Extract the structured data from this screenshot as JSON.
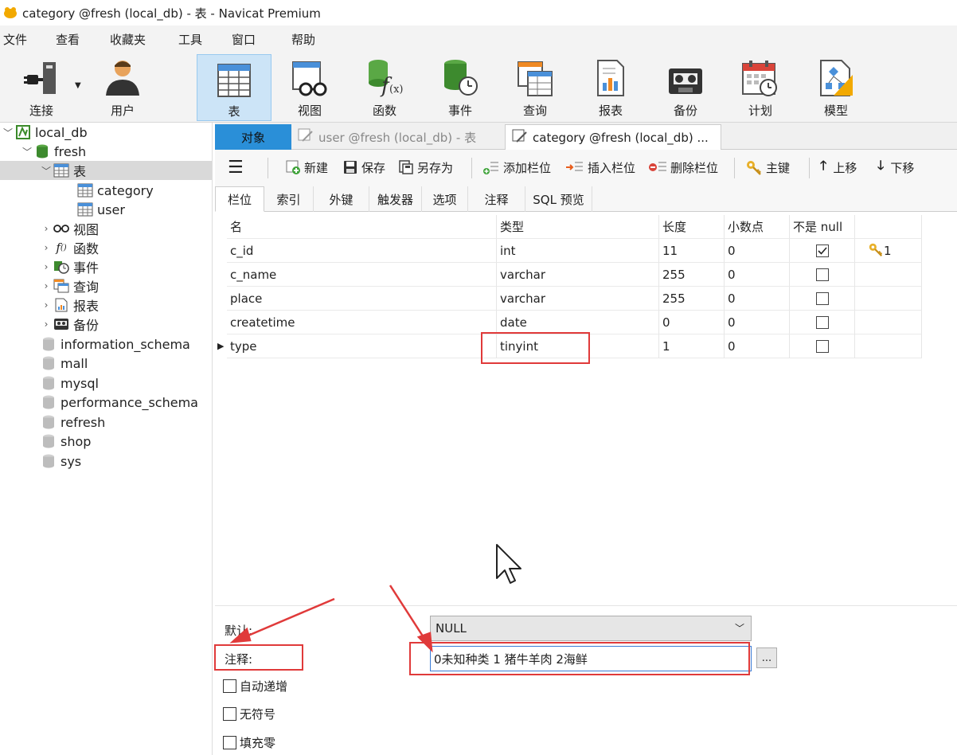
{
  "window": {
    "title": "category @fresh (local_db) - 表 - Navicat Premium"
  },
  "menu": [
    "文件",
    "查看",
    "收藏夹",
    "工具",
    "窗口",
    "帮助"
  ],
  "toolbar": {
    "connect": "连接",
    "user": "用户",
    "table": "表",
    "view": "视图",
    "function": "函数",
    "event": "事件",
    "query": "查询",
    "report": "报表",
    "backup": "备份",
    "schedule": "计划",
    "model": "模型"
  },
  "sidebar": {
    "connection": "local_db",
    "db_fresh": "fresh",
    "tables_node": "表",
    "tables": [
      "category",
      "user"
    ],
    "nodes": [
      "视图",
      "函数",
      "事件",
      "查询",
      "报表",
      "备份"
    ],
    "databases": [
      "information_schema",
      "mall",
      "mysql",
      "performance_schema",
      "refresh",
      "shop",
      "sys"
    ]
  },
  "objtabs": {
    "objects": "对象",
    "tab1": "user @fresh (local_db) - 表",
    "tab2": "category @fresh (local_db) ..."
  },
  "subtoolbar": {
    "new": "新建",
    "save": "保存",
    "save_as": "另存为",
    "add_field": "添加栏位",
    "insert_field": "插入栏位",
    "delete_field": "删除栏位",
    "primary_key": "主键",
    "move_up": "上移",
    "move_down": "下移"
  },
  "fieldtabs": [
    "栏位",
    "索引",
    "外键",
    "触发器",
    "选项",
    "注释",
    "SQL 预览"
  ],
  "grid": {
    "headers": [
      "名",
      "类型",
      "长度",
      "小数点",
      "不是 null",
      ""
    ],
    "rows": [
      {
        "name": "c_id",
        "type": "int",
        "length": "11",
        "decimals": "0",
        "not_null": true,
        "key": "1"
      },
      {
        "name": "c_name",
        "type": "varchar",
        "length": "255",
        "decimals": "0",
        "not_null": false,
        "key": ""
      },
      {
        "name": "place",
        "type": "varchar",
        "length": "255",
        "decimals": "0",
        "not_null": false,
        "key": ""
      },
      {
        "name": "createtime",
        "type": "date",
        "length": "0",
        "decimals": "0",
        "not_null": false,
        "key": ""
      },
      {
        "name": "type",
        "type": "tinyint",
        "length": "1",
        "decimals": "0",
        "not_null": false,
        "key": ""
      }
    ]
  },
  "properties": {
    "default_label": "默认:",
    "default_value": "NULL",
    "comment_label": "注释:",
    "comment_value": "0未知种类 1 猪牛羊肉 2海鲜",
    "ellipsis": "...",
    "auto_increment": "自动递增",
    "unsigned": "无符号",
    "zerofill": "填充零"
  },
  "colors": {
    "annotation_red": "#e03a3a",
    "selection_blue": "#cce4f7",
    "objects_tab": "#2a8fd8"
  }
}
